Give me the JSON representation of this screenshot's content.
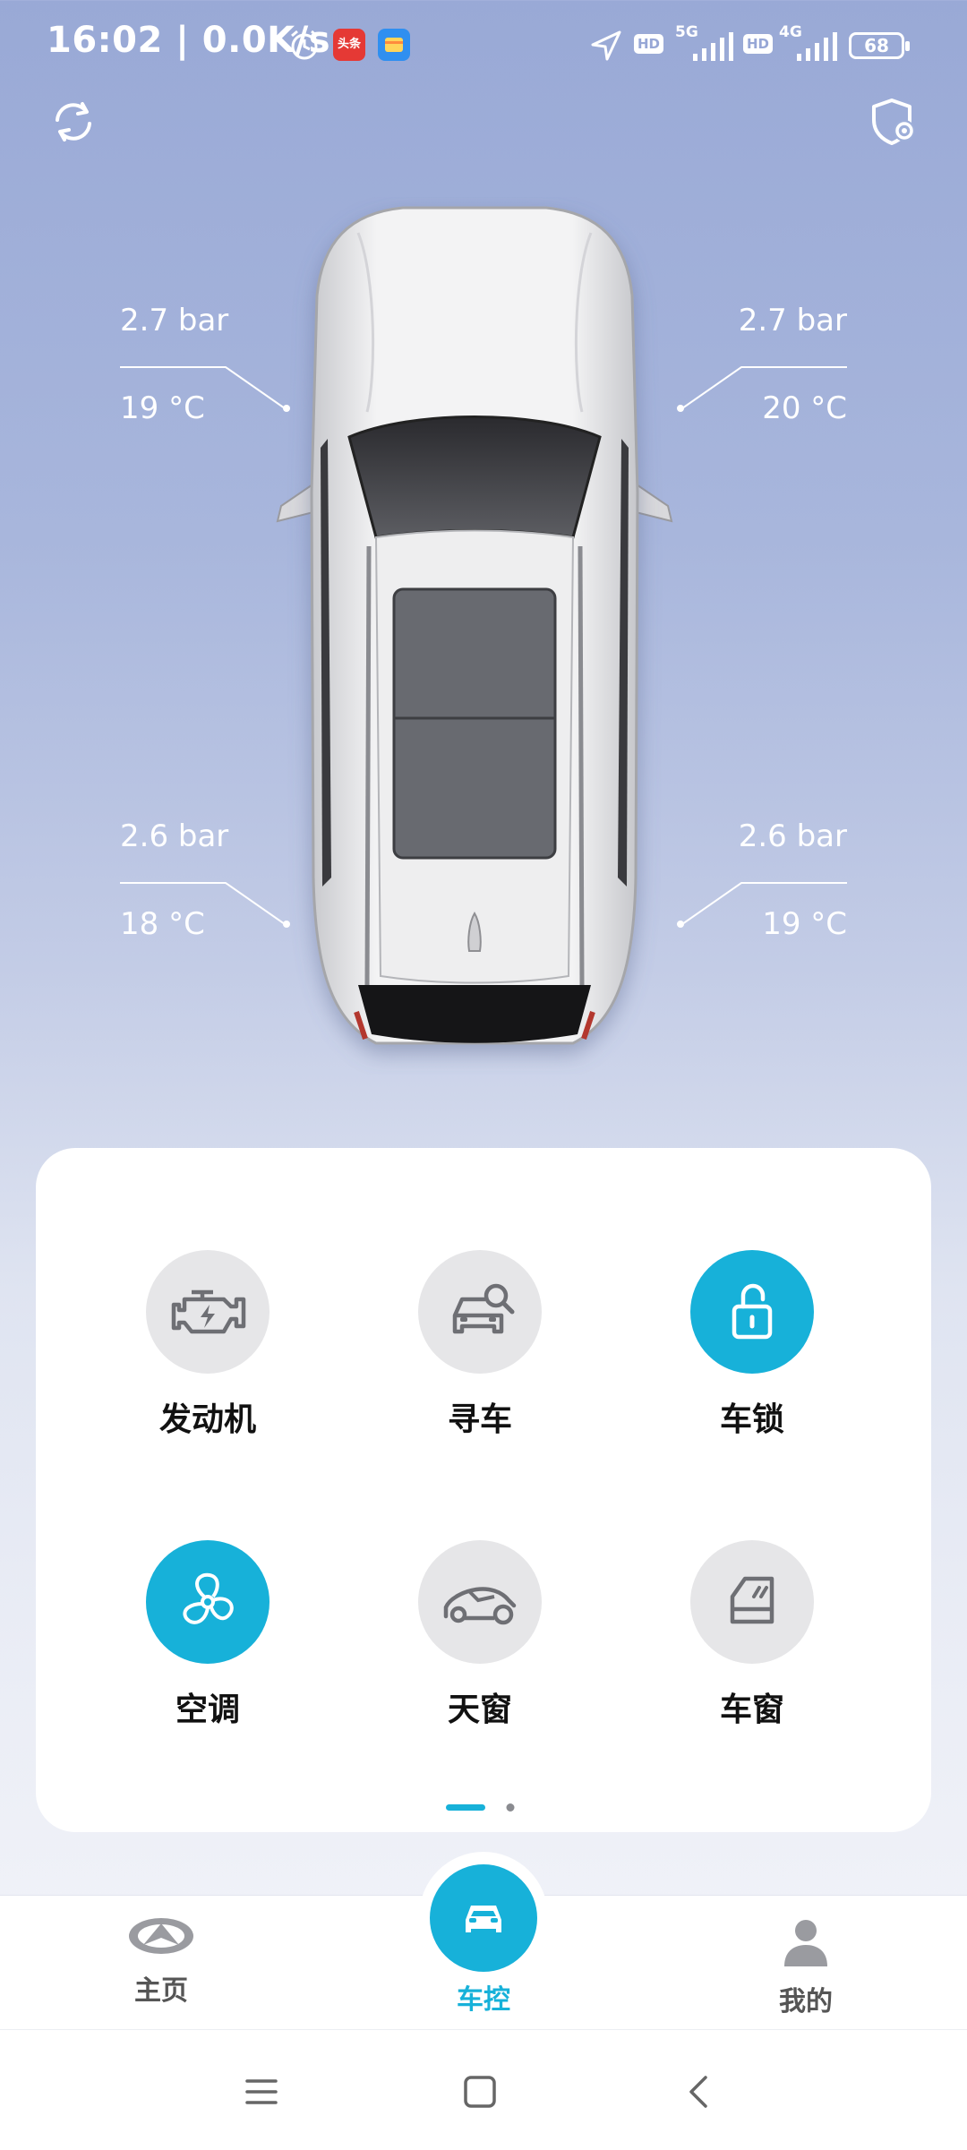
{
  "status_bar": {
    "time": "16:02",
    "net_speed": "| 0.0K/s",
    "app_badge_1": "头条",
    "signal_1_label": "5G",
    "signal_2_label": "4G",
    "hd_label": "HD",
    "battery": "68"
  },
  "tires": {
    "front_left": {
      "pressure": "2.7 bar",
      "temp": "19 °C"
    },
    "front_right": {
      "pressure": "2.7 bar",
      "temp": "20 °C"
    },
    "rear_left": {
      "pressure": "2.6 bar",
      "temp": "18 °C"
    },
    "rear_right": {
      "pressure": "2.6 bar",
      "temp": "19 °C"
    }
  },
  "controls": [
    {
      "label": "发动机",
      "icon": "engine-icon",
      "active": false
    },
    {
      "label": "寻车",
      "icon": "find-car-icon",
      "active": false
    },
    {
      "label": "车锁",
      "icon": "unlock-icon",
      "active": true
    },
    {
      "label": "空调",
      "icon": "fan-icon",
      "active": true
    },
    {
      "label": "天窗",
      "icon": "sunroof-icon",
      "active": false
    },
    {
      "label": "车窗",
      "icon": "window-icon",
      "active": false
    }
  ],
  "pager": {
    "pages": 2,
    "current": 1
  },
  "bottom_nav": {
    "home": "主页",
    "car_control": "车控",
    "mine": "我的"
  },
  "colors": {
    "accent": "#17b1d9",
    "inactive_circle": "#e6e6e8"
  }
}
